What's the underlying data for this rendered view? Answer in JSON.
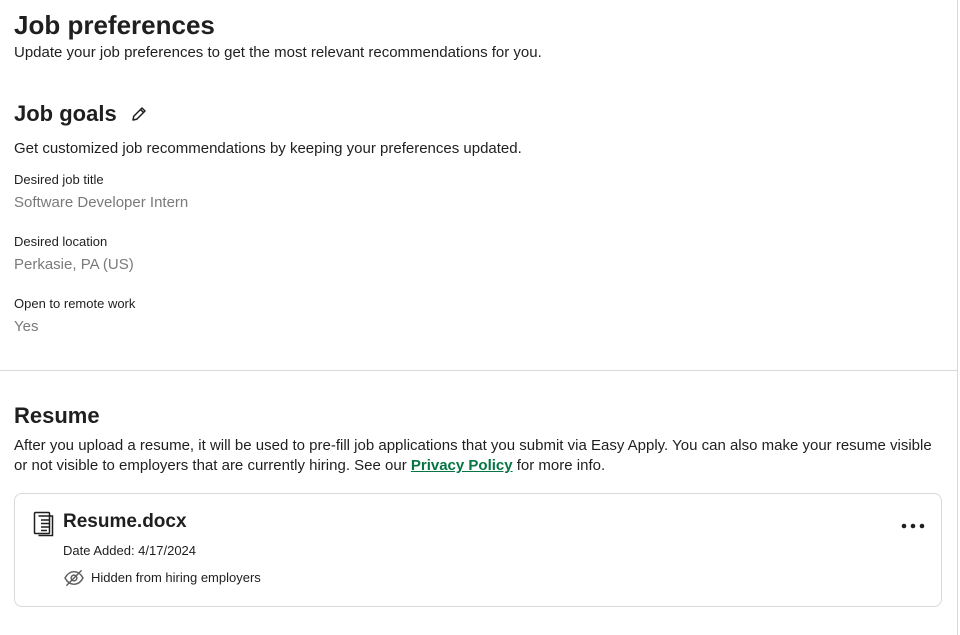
{
  "header": {
    "title": "Job preferences",
    "subtitle": "Update your job preferences to get the most relevant recommendations for you."
  },
  "job_goals": {
    "title": "Job goals",
    "edit_icon": "pencil-icon",
    "description": "Get customized job recommendations by keeping your preferences updated.",
    "fields": [
      {
        "label": "Desired job title",
        "value": "Software Developer Intern"
      },
      {
        "label": "Desired location",
        "value": "Perkasie, PA (US)"
      },
      {
        "label": "Open to remote work",
        "value": "Yes"
      }
    ]
  },
  "resume": {
    "title": "Resume",
    "description_before": "After you upload a resume, it will be used to pre-fill job applications that you submit via Easy Apply. You can also make your resume visible or not visible to employers that are currently hiring. See our ",
    "link_text": "Privacy Policy",
    "description_after": " for more info.",
    "file": {
      "icon": "document-icon",
      "name": "Resume.docx",
      "date_added": "Date Added: 4/17/2024",
      "visibility_icon": "eye-slash-icon",
      "visibility_text": "Hidden from hiring employers",
      "menu_icon": "more-horizontal-icon"
    }
  },
  "colors": {
    "text": "#1f1f1f",
    "muted": "#7a7a7a",
    "link": "#057642",
    "border": "#d9d9d9"
  }
}
